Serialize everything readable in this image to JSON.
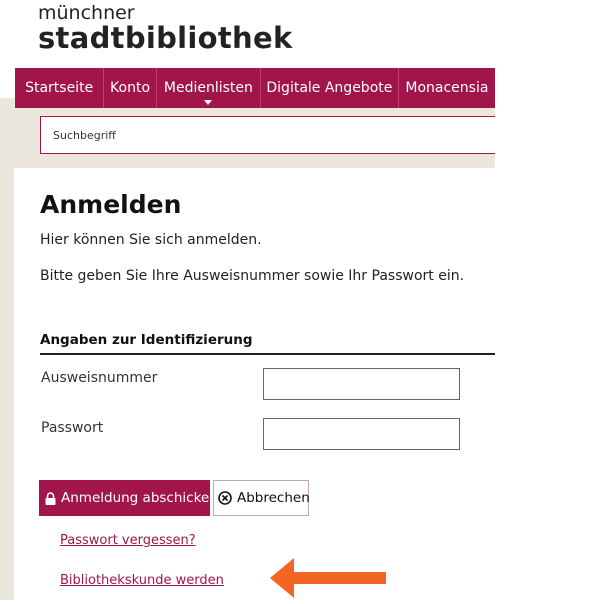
{
  "logo": {
    "line1": "münchner",
    "line2": "stadtbibliothek"
  },
  "nav": {
    "items": [
      {
        "label": "Startseite"
      },
      {
        "label": "Konto"
      },
      {
        "label": "Medienlisten"
      },
      {
        "label": "Digitale Angebote"
      },
      {
        "label": "Monacensia"
      }
    ]
  },
  "search": {
    "placeholder": "Suchbegriff",
    "value": ""
  },
  "page": {
    "title": "Anmelden",
    "intro": "Hier können Sie sich anmelden.",
    "instruction": "Bitte geben Sie Ihre Ausweisnummer sowie Ihr Passwort ein."
  },
  "form": {
    "section_title": "Angaben zur Identifizierung",
    "card_label": "Ausweisnummer",
    "card_value": "",
    "password_label": "Passwort",
    "password_value": "",
    "submit_label": "Anmeldung abschicken",
    "cancel_label": "Abbrechen"
  },
  "links": {
    "forgot_password": "Passwort vergessen?",
    "become_customer": "Bibliothekskunde werden"
  },
  "colors": {
    "brand": "#a1154a",
    "arrow": "#f26522",
    "background_band": "#ece7dc"
  },
  "icons": {
    "submit": "lock-icon",
    "cancel": "cancel-circle-icon",
    "annotation": "arrow-left-icon"
  }
}
